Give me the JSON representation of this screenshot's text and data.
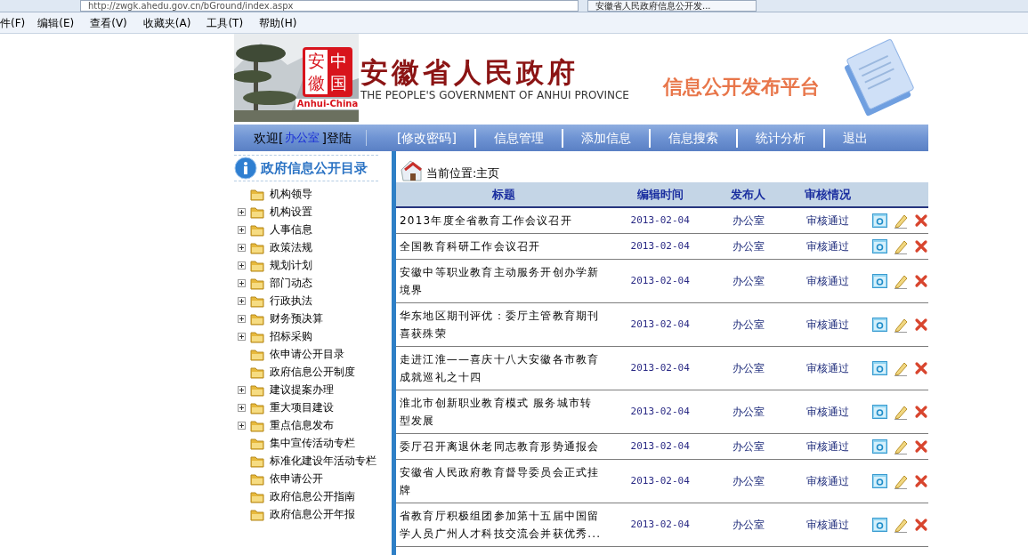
{
  "browser": {
    "address": "http://zwgk.ahedu.gov.cn/bGround/index.aspx",
    "tab_title": "安徽省人民政府信息公开发...",
    "menu": [
      "件(F)",
      "编辑(E)",
      "查看(V)",
      "收藏夹(A)",
      "工具(T)",
      "帮助(H)"
    ]
  },
  "header": {
    "seal": [
      "安",
      "中",
      "徽",
      "国"
    ],
    "seal_caption": "Anhui-China",
    "title": "安徽省人民政府",
    "subtitle": "THE PEOPLE'S GOVERNMENT OF ANHUI PROVINCE",
    "platform": "信息公开发布平台"
  },
  "nav": {
    "welcome_prefix": "欢迎[",
    "user": "办公室",
    "welcome_suffix": "]登陆",
    "items": [
      "[修改密码]",
      "信息管理",
      "添加信息",
      "信息搜索",
      "统计分析",
      "退出"
    ]
  },
  "sidebar": {
    "title": "政府信息公开目录",
    "items": [
      {
        "label": "机构领导",
        "expandable": false
      },
      {
        "label": "机构设置",
        "expandable": true
      },
      {
        "label": "人事信息",
        "expandable": true
      },
      {
        "label": "政策法规",
        "expandable": true
      },
      {
        "label": "规划计划",
        "expandable": true
      },
      {
        "label": "部门动态",
        "expandable": true
      },
      {
        "label": "行政执法",
        "expandable": true
      },
      {
        "label": "财务预决算",
        "expandable": true
      },
      {
        "label": "招标采购",
        "expandable": true
      },
      {
        "label": "依申请公开目录",
        "expandable": false
      },
      {
        "label": "政府信息公开制度",
        "expandable": false
      },
      {
        "label": "建议提案办理",
        "expandable": true
      },
      {
        "label": "重大项目建设",
        "expandable": true
      },
      {
        "label": "重点信息发布",
        "expandable": true
      },
      {
        "label": "集中宣传活动专栏",
        "expandable": false
      },
      {
        "label": "标准化建设年活动专栏",
        "expandable": false
      },
      {
        "label": "依申请公开",
        "expandable": false
      },
      {
        "label": "政府信息公开指南",
        "expandable": false
      },
      {
        "label": "政府信息公开年报",
        "expandable": false
      }
    ]
  },
  "breadcrumb": "当前位置:主页",
  "table": {
    "columns": [
      "标题",
      "编辑时间",
      "发布人",
      "审核情况"
    ],
    "rows": [
      {
        "title": "2013年度全省教育工作会议召开",
        "date": "2013-02-04",
        "publisher": "办公室",
        "status": "审核通过"
      },
      {
        "title": "全国教育科研工作会议召开",
        "date": "2013-02-04",
        "publisher": "办公室",
        "status": "审核通过"
      },
      {
        "title": "安徽中等职业教育主动服务开创办学新境界",
        "date": "2013-02-04",
        "publisher": "办公室",
        "status": "审核通过"
      },
      {
        "title": "华东地区期刊评优：委厅主管教育期刊喜获殊荣",
        "date": "2013-02-04",
        "publisher": "办公室",
        "status": "审核通过"
      },
      {
        "title": "走进江淮——喜庆十八大安徽各市教育成就巡礼之十四",
        "date": "2013-02-04",
        "publisher": "办公室",
        "status": "审核通过"
      },
      {
        "title": "淮北市创新职业教育模式 服务城市转型发展",
        "date": "2013-02-04",
        "publisher": "办公室",
        "status": "审核通过"
      },
      {
        "title": "委厅召开离退休老同志教育形势通报会",
        "date": "2013-02-04",
        "publisher": "办公室",
        "status": "审核通过"
      },
      {
        "title": "安徽省人民政府教育督导委员会正式挂牌",
        "date": "2013-02-04",
        "publisher": "办公室",
        "status": "审核通过"
      },
      {
        "title": "省教育厅积极组团参加第十五届中国留学人员广州人才科技交流会并获优秀...",
        "date": "2013-02-04",
        "publisher": "办公室",
        "status": "审核通过"
      }
    ]
  }
}
